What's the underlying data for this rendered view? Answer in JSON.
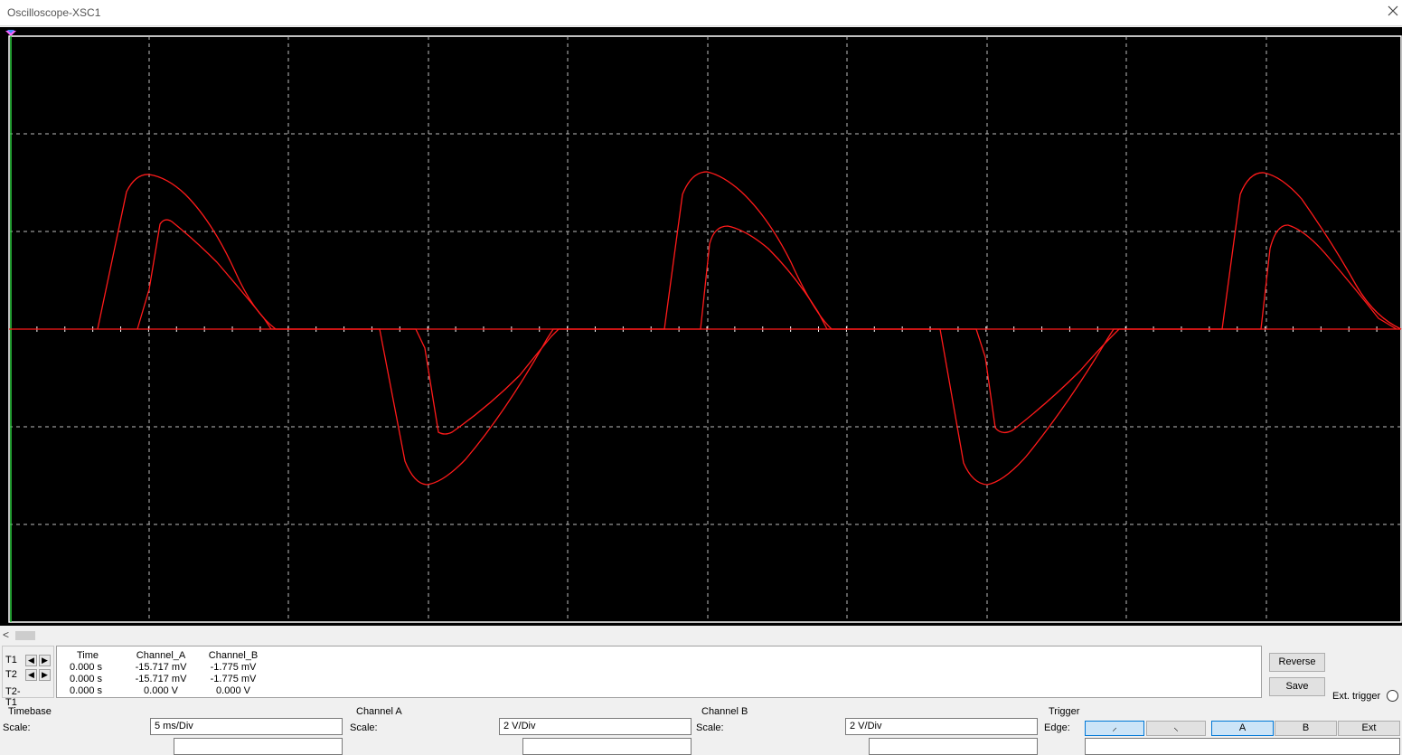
{
  "window": {
    "title": "Oscilloscope-XSC1"
  },
  "scroll": {
    "left_arrow": "<"
  },
  "cursors": {
    "rows": [
      {
        "label": "T1"
      },
      {
        "label": "T2"
      },
      {
        "label": "T2-T1"
      }
    ],
    "headers": [
      "Time",
      "Channel_A",
      "Channel_B"
    ],
    "values": [
      [
        "0.000 s",
        "-15.717 mV",
        "-1.775 mV"
      ],
      [
        "0.000 s",
        "-15.717 mV",
        "-1.775 mV"
      ],
      [
        "0.000 s",
        "0.000 V",
        "0.000 V"
      ]
    ]
  },
  "buttons": {
    "reverse": "Reverse",
    "save": "Save"
  },
  "ext_trigger": "Ext. trigger",
  "timebase": {
    "title": "Timebase",
    "scale_label": "Scale:",
    "scale_value": "5 ms/Div"
  },
  "channel_a": {
    "title": "Channel A",
    "scale_label": "Scale:",
    "scale_value": "2  V/Div"
  },
  "channel_b": {
    "title": "Channel B",
    "scale_label": "Scale:",
    "scale_value": "2  V/Div"
  },
  "trigger": {
    "title": "Trigger",
    "edge_label": "Edge:",
    "edge_rising_glyph": "⸝",
    "edge_falling_glyph": "⸜",
    "source_a": "A",
    "source_b": "B",
    "source_ext": "Ext",
    "active_source": "A"
  },
  "colors": {
    "trace": "#ff1a1a",
    "grid": "#c8c8c8",
    "background": "#000000"
  }
}
